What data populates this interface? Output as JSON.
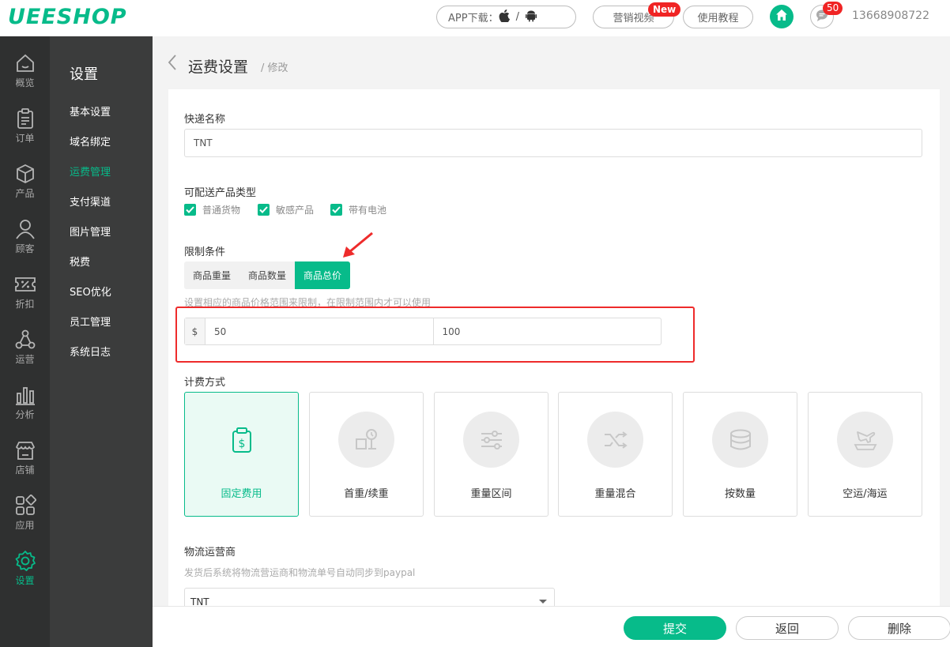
{
  "header": {
    "logo": "UEESHOP",
    "app_download": "APP下载：",
    "marketing_video": "营销视频",
    "new_badge": "New",
    "tutorial": "使用教程",
    "message_count": "50",
    "user": "13668908722"
  },
  "rail": [
    {
      "label": "概览",
      "icon": "home-outline-icon"
    },
    {
      "label": "订单",
      "icon": "clipboard-icon"
    },
    {
      "label": "产品",
      "icon": "box-icon"
    },
    {
      "label": "顾客",
      "icon": "user-icon"
    },
    {
      "label": "折扣",
      "icon": "percent-ticket-icon"
    },
    {
      "label": "运营",
      "icon": "network-icon"
    },
    {
      "label": "分析",
      "icon": "bar-chart-icon"
    },
    {
      "label": "店铺",
      "icon": "store-icon"
    },
    {
      "label": "应用",
      "icon": "apps-icon"
    },
    {
      "label": "设置",
      "icon": "gear-icon"
    }
  ],
  "subnav": {
    "title": "设置",
    "items": [
      "基本设置",
      "域名绑定",
      "运费管理",
      "支付渠道",
      "图片管理",
      "税费",
      "SEO优化",
      "员工管理",
      "系统日志"
    ],
    "active_index": 2
  },
  "page": {
    "title": "运费设置",
    "crumb": "/ 修改"
  },
  "form": {
    "express_name_label": "快递名称",
    "express_name_value": "TNT",
    "product_types_label": "可配送产品类型",
    "product_types": [
      "普通货物",
      "敏感产品",
      "带有电池"
    ],
    "restriction_label": "限制条件",
    "restriction_tabs": [
      "商品重量",
      "商品数量",
      "商品总价"
    ],
    "restriction_active": 2,
    "restriction_hint": "设置相应的商品价格范围来限制，在限制范围内才可以使用",
    "currency": "$",
    "range_min": "50",
    "range_max": "100",
    "billing_label": "计费方式",
    "billing_methods": [
      {
        "name": "固定费用",
        "icon": "fixed-fee-clipboard-icon"
      },
      {
        "name": "首重/续重",
        "icon": "scale-icon"
      },
      {
        "name": "重量区间",
        "icon": "sliders-icon"
      },
      {
        "name": "重量混合",
        "icon": "shuffle-icon"
      },
      {
        "name": "按数量",
        "icon": "stack-icon"
      },
      {
        "name": "空运/海运",
        "icon": "plane-ship-icon"
      }
    ],
    "billing_active": 0,
    "carrier_label": "物流运营商",
    "carrier_hint": "发货后系统将物流营运商和物流单号自动同步到paypal",
    "carrier_value": "TNT"
  },
  "footer": {
    "submit": "提交",
    "back": "返回",
    "delete": "删除"
  },
  "colors": {
    "accent": "#07bb8a",
    "alert": "#ee2b2b"
  }
}
